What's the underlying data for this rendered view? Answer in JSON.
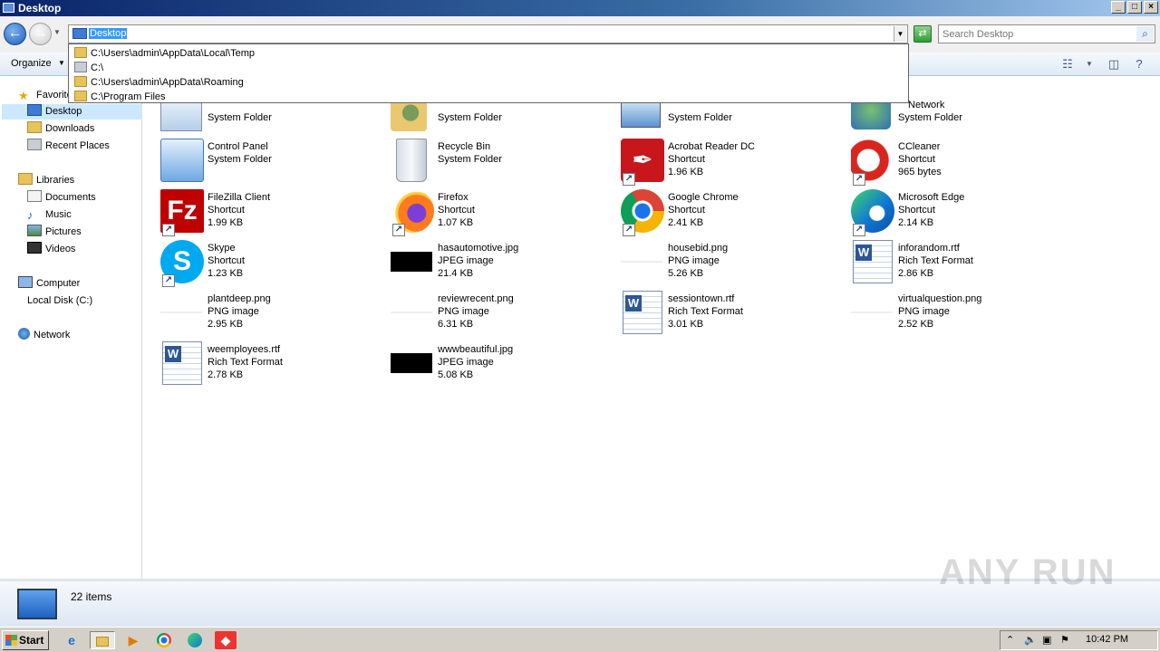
{
  "window": {
    "title": "Desktop"
  },
  "address": {
    "value": "Desktop"
  },
  "search": {
    "placeholder": "Search Desktop"
  },
  "toolbar": {
    "organize_label": "Organize"
  },
  "dropdown": {
    "items": [
      {
        "label": "C:\\Users\\admin\\AppData\\Local\\Temp"
      },
      {
        "label": "C:\\"
      },
      {
        "label": "C:\\Users\\admin\\AppData\\Roaming"
      },
      {
        "label": "C:\\Program Files"
      }
    ]
  },
  "sidebar": {
    "favorites": "Favorites",
    "desktop": "Desktop",
    "downloads": "Downloads",
    "recent": "Recent Places",
    "libraries": "Libraries",
    "documents": "Documents",
    "music": "Music",
    "pictures": "Pictures",
    "videos": "Videos",
    "computer": "Computer",
    "local_disk": "Local Disk (C:)",
    "network": "Network"
  },
  "items": [
    {
      "name": "",
      "type": "System Folder",
      "size": ""
    },
    {
      "name": "",
      "type": "System Folder",
      "size": ""
    },
    {
      "name": "",
      "type": "System Folder",
      "size": ""
    },
    {
      "name": "Network",
      "type": "System Folder",
      "size": ""
    },
    {
      "name": "Control Panel",
      "type": "System Folder",
      "size": ""
    },
    {
      "name": "Recycle Bin",
      "type": "System Folder",
      "size": ""
    },
    {
      "name": "Acrobat Reader DC",
      "type": "Shortcut",
      "size": "1.96 KB"
    },
    {
      "name": "CCleaner",
      "type": "Shortcut",
      "size": "965 bytes"
    },
    {
      "name": "FileZilla Client",
      "type": "Shortcut",
      "size": "1.99 KB"
    },
    {
      "name": "Firefox",
      "type": "Shortcut",
      "size": "1.07 KB"
    },
    {
      "name": "Google Chrome",
      "type": "Shortcut",
      "size": "2.41 KB"
    },
    {
      "name": "Microsoft Edge",
      "type": "Shortcut",
      "size": "2.14 KB"
    },
    {
      "name": "Skype",
      "type": "Shortcut",
      "size": "1.23 KB"
    },
    {
      "name": "hasautomotive.jpg",
      "type": "JPEG image",
      "size": "21.4 KB"
    },
    {
      "name": "housebid.png",
      "type": "PNG image",
      "size": "5.26 KB"
    },
    {
      "name": "inforandom.rtf",
      "type": "Rich Text Format",
      "size": "2.86 KB"
    },
    {
      "name": "plantdeep.png",
      "type": "PNG image",
      "size": "2.95 KB"
    },
    {
      "name": "reviewrecent.png",
      "type": "PNG image",
      "size": "6.31 KB"
    },
    {
      "name": "sessiontown.rtf",
      "type": "Rich Text Format",
      "size": "3.01 KB"
    },
    {
      "name": "virtualquestion.png",
      "type": "PNG image",
      "size": "2.52 KB"
    },
    {
      "name": "weemployees.rtf",
      "type": "Rich Text Format",
      "size": "2.78 KB"
    },
    {
      "name": "wwwbeautiful.jpg",
      "type": "JPEG image",
      "size": "5.08 KB"
    }
  ],
  "status": {
    "count": "22 items"
  },
  "taskbar": {
    "start_label": "Start",
    "clock": "10:42 PM"
  },
  "watermark": "ANY RUN"
}
